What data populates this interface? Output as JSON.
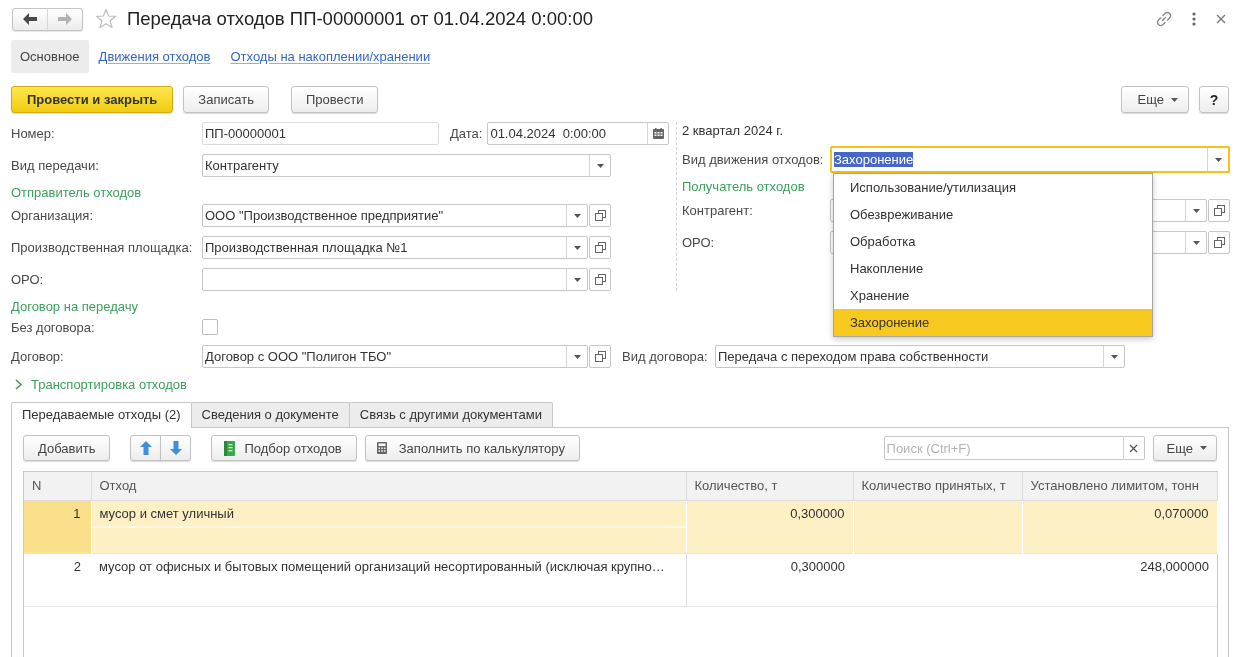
{
  "window": {
    "title": "Передача отходов ПП-00000001 от 01.04.2024 0:00:00"
  },
  "nav_buttons": [
    {
      "kind": "back",
      "disabled": false
    },
    {
      "kind": "forward",
      "disabled": true
    }
  ],
  "sections": [
    {
      "label": "Основное",
      "selected": true
    },
    {
      "label": "Движения отходов",
      "selected": false
    },
    {
      "label": "Отходы на накоплении/хранении",
      "selected": false
    }
  ],
  "command_bar": {
    "buttons": [
      {
        "label": "Провести и закрыть",
        "kind": "primary"
      },
      {
        "label": "Записать",
        "kind": "default"
      },
      {
        "label": "Провести",
        "kind": "default"
      }
    ],
    "more": "Еще",
    "help": "?"
  },
  "header": {
    "number": {
      "label": "Номер:",
      "value": "ПП-00000001"
    },
    "date": {
      "label": "Дата:",
      "value": "01.04.2024  0:00:00"
    },
    "period": "2 квартал 2024 г."
  },
  "left_fields": [
    {
      "kind": "field",
      "label": "Вид передачи:",
      "value": "Контрагенту",
      "open_button": false
    },
    {
      "kind": "group",
      "label": "Отправитель отходов"
    },
    {
      "kind": "field",
      "label": "Организация:",
      "value": "ООО \"Производственное предприятие\"",
      "open_button": true
    },
    {
      "kind": "field",
      "label": "Производственная площадка:",
      "value": "Производственная площадка №1",
      "open_button": true
    },
    {
      "kind": "field",
      "label": "ОРО:",
      "open_button": true
    }
  ],
  "right_fields": [
    {
      "kind": "select",
      "label": "Вид движения отходов:",
      "value": "Захоронение",
      "focused": true,
      "expanded": true,
      "options": [
        {
          "label": "Использование/утилизация",
          "selected": false
        },
        {
          "label": "Обезвреживание",
          "selected": false
        },
        {
          "label": "Обработка",
          "selected": false
        },
        {
          "label": "Накопление",
          "selected": false
        },
        {
          "label": "Хранение",
          "selected": false
        },
        {
          "label": "Захоронение",
          "selected": true
        }
      ]
    },
    {
      "kind": "group",
      "label": "Получатель отходов"
    },
    {
      "kind": "field",
      "label": "Контрагент:",
      "open_button": true
    },
    {
      "kind": "field",
      "label": "ОРО:",
      "open_button": true
    }
  ],
  "contract": {
    "title": "Договор на передачу",
    "no_contract": {
      "label": "Без договора:",
      "checked": false
    },
    "contract": {
      "label": "Договор:",
      "value": "Договор с ООО \"Полигон ТБО\""
    },
    "contract_type": {
      "label": "Вид договора:",
      "value": "Передача с переходом права собственности"
    }
  },
  "transport": {
    "label": "Транспортировка отходов",
    "expanded": false
  },
  "tabs": [
    {
      "label": "Передаваемые отходы (2)",
      "selected": true
    },
    {
      "label": "Сведения о документе",
      "selected": false
    },
    {
      "label": "Связь с другими документами",
      "selected": false
    }
  ],
  "table_toolbar": {
    "add": "Добавить",
    "pick": "Подбор отходов",
    "fill": "Заполнить по калькулятору",
    "search": {
      "placeholder": "Поиск (Ctrl+F)"
    },
    "more": "Еще"
  },
  "table": {
    "columns": [
      "N",
      "Отход",
      "Количество, т",
      "Количество принятых, т",
      "Установлено лимитом, тонн"
    ],
    "rows": [
      {
        "n": "1",
        "waste": "мусор и смет уличный",
        "quantity": "0,300000",
        "limit": "0,070000",
        "selected": true
      },
      {
        "n": "2",
        "waste": "мусор от офисных и бытовых помещений организаций несортированный (исключая крупно…",
        "quantity": "0,300000",
        "limit": "248,000000",
        "selected": false
      }
    ]
  }
}
